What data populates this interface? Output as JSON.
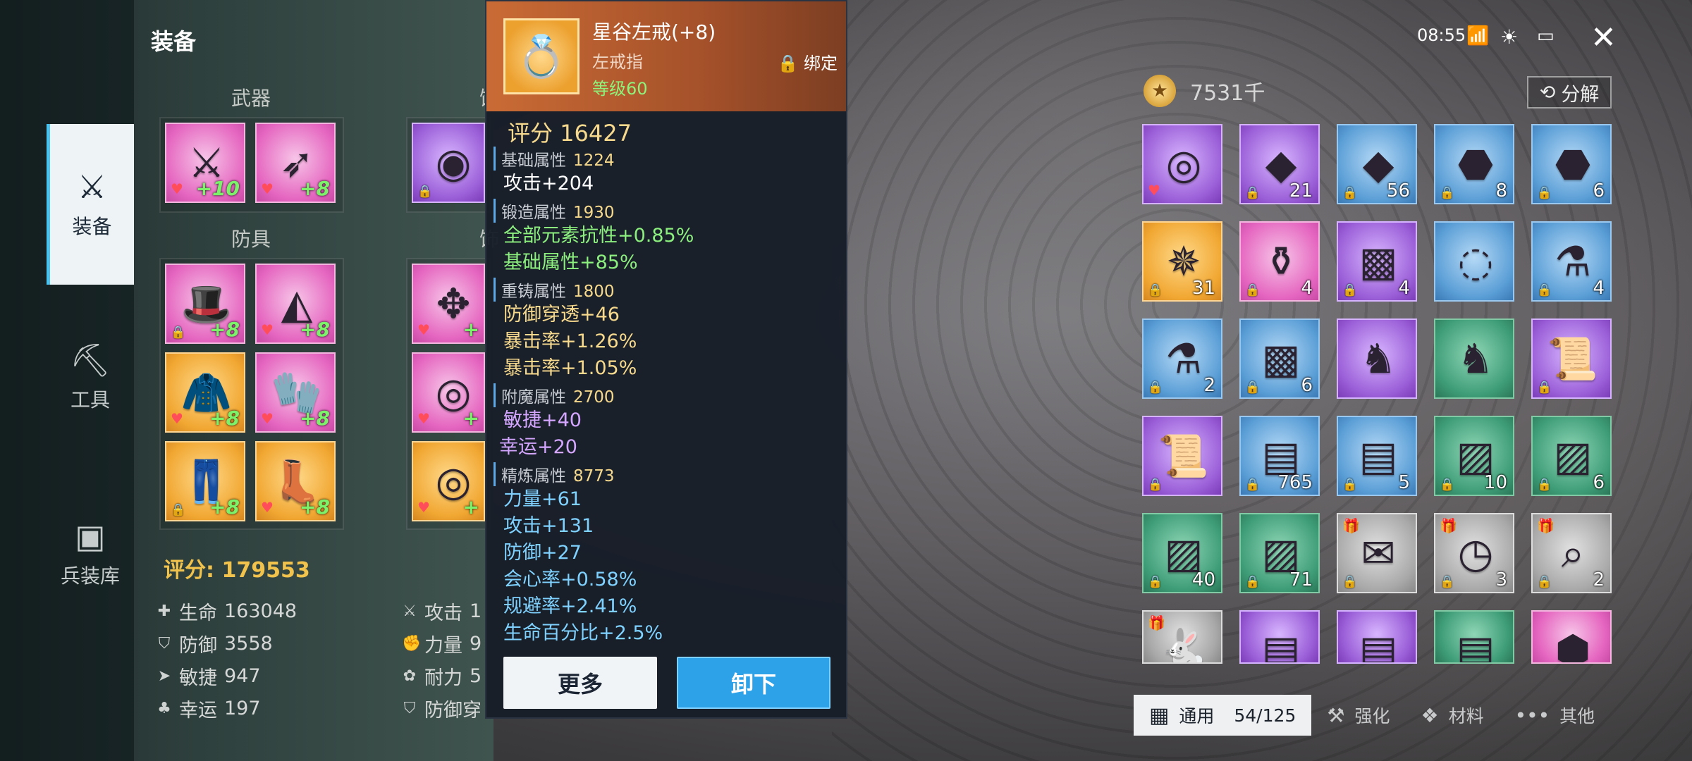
{
  "header": {
    "title": "装备",
    "time": "08:55"
  },
  "nav": [
    {
      "label": "装备",
      "icon": "sword-bag-icon",
      "active": true
    },
    {
      "label": "工具",
      "icon": "pickaxe-icon",
      "active": false
    },
    {
      "label": "兵装库",
      "icon": "chest-icon",
      "active": false
    }
  ],
  "equip": {
    "weapon_label": "武器",
    "armor_label": "防具",
    "weapons": [
      {
        "plus": "+10"
      },
      {
        "plus": "+8"
      }
    ],
    "armor": [
      {
        "plus": "+8"
      },
      {
        "plus": "+8"
      },
      {
        "plus": "+8"
      },
      {
        "plus": "+8"
      },
      {
        "plus": "+8"
      },
      {
        "plus": "+8"
      }
    ],
    "acc_label_a": "饰",
    "acc_label_b": "饰",
    "accessories": [
      {
        "plus": "+"
      },
      {
        "plus": "+"
      },
      {
        "plus": "+"
      }
    ],
    "score_label": "评分:",
    "score_value": "179553"
  },
  "stats": {
    "left": [
      {
        "icon": "heart-icon",
        "label": "生命",
        "value": "163048"
      },
      {
        "icon": "shield-icon",
        "label": "防御",
        "value": "3558"
      },
      {
        "icon": "agility-icon",
        "label": "敏捷",
        "value": "947"
      },
      {
        "icon": "clover-icon",
        "label": "幸运",
        "value": "197"
      }
    ],
    "right": [
      {
        "icon": "attack-icon",
        "label": "攻击",
        "value": "1"
      },
      {
        "icon": "strength-icon",
        "label": "力量",
        "value": "9"
      },
      {
        "icon": "paw-icon",
        "label": "耐力",
        "value": "5"
      },
      {
        "icon": "shield-pierce-icon",
        "label": "防御穿",
        "value": ""
      }
    ]
  },
  "tooltip": {
    "name": "星谷左戒(+8)",
    "type": "左戒指",
    "level": "等级60",
    "bind": "绑定",
    "score_text": "评分 16427",
    "sections": [
      {
        "title": "基础属性",
        "value": "1224",
        "lines": [
          {
            "text": "攻击+204",
            "color": "white"
          }
        ]
      },
      {
        "title": "锻造属性",
        "value": "1930",
        "lines": [
          {
            "text": "全部元素抗性+0.85%",
            "color": "green"
          },
          {
            "text": "基础属性+85%",
            "color": "green"
          }
        ]
      },
      {
        "title": "重铸属性",
        "value": "1800",
        "lines": [
          {
            "text": "防御穿透+46",
            "color": "yellow"
          },
          {
            "text": "暴击率+1.26%",
            "color": "yellow"
          },
          {
            "text": "暴击率+1.05%",
            "color": "yellow"
          }
        ]
      },
      {
        "title": "附魔属性",
        "value": "2700",
        "lines": [
          {
            "text": "敏捷+40",
            "color": "violet"
          },
          {
            "text": "幸运+20",
            "color": "violet"
          }
        ]
      },
      {
        "title": "精炼属性",
        "value": "8773",
        "lines": [
          {
            "text": "力量+61",
            "color": "cyan"
          },
          {
            "text": "攻击+131",
            "color": "cyan"
          },
          {
            "text": "防御+27",
            "color": "cyan"
          },
          {
            "text": "会心率+0.58%",
            "color": "cyan"
          },
          {
            "text": "规避率+2.41%",
            "color": "cyan"
          },
          {
            "text": "生命百分比+2.5%",
            "color": "cyan"
          }
        ]
      }
    ],
    "btn_more": "更多",
    "btn_unequip": "卸下"
  },
  "inventory": {
    "gold": "7531千",
    "decompose": "分解",
    "items": [
      {
        "icon": "ring-icon",
        "bg": "purple",
        "count": "",
        "heart": true,
        "lock": false,
        "gift": false
      },
      {
        "icon": "purple-crystal-icon",
        "bg": "purple",
        "count": "21",
        "heart": false,
        "lock": true,
        "gift": false
      },
      {
        "icon": "blue-crystal-icon",
        "bg": "blue",
        "count": "56",
        "heart": false,
        "lock": true,
        "gift": false
      },
      {
        "icon": "rune-stone-icon",
        "bg": "blue",
        "count": "8",
        "heart": false,
        "lock": true,
        "gift": false
      },
      {
        "icon": "rune-stone-icon",
        "bg": "blue",
        "count": "6",
        "heart": false,
        "lock": true,
        "gift": false
      },
      {
        "icon": "compass-icon",
        "bg": "gold",
        "count": "31",
        "heart": false,
        "lock": true,
        "gift": false
      },
      {
        "icon": "bottle-icon",
        "bg": "pink",
        "count": "4",
        "heart": false,
        "lock": true,
        "gift": false
      },
      {
        "icon": "cube-icon",
        "bg": "purple",
        "count": "4",
        "heart": false,
        "lock": true,
        "gift": false
      },
      {
        "icon": "powder-icon",
        "bg": "blue",
        "count": "",
        "heart": false,
        "lock": false,
        "gift": false
      },
      {
        "icon": "potion-icon",
        "bg": "blue",
        "count": "4",
        "heart": false,
        "lock": true,
        "gift": false
      },
      {
        "icon": "potion-icon",
        "bg": "blue",
        "count": "2",
        "heart": false,
        "lock": true,
        "gift": false
      },
      {
        "icon": "cube-icon",
        "bg": "blue",
        "count": "6",
        "heart": false,
        "lock": true,
        "gift": false
      },
      {
        "icon": "horse-icon",
        "bg": "purple",
        "count": "",
        "heart": false,
        "lock": false,
        "gift": false
      },
      {
        "icon": "horse-icon",
        "bg": "green",
        "count": "",
        "heart": false,
        "lock": false,
        "gift": false
      },
      {
        "icon": "scroll-icon",
        "bg": "purple",
        "count": "",
        "heart": false,
        "lock": true,
        "gift": false
      },
      {
        "icon": "scroll-icon",
        "bg": "purple",
        "count": "",
        "heart": false,
        "lock": true,
        "gift": false
      },
      {
        "icon": "case-icon",
        "bg": "blue",
        "count": "765",
        "heart": false,
        "lock": true,
        "gift": false
      },
      {
        "icon": "case-icon",
        "bg": "blue",
        "count": "5",
        "heart": false,
        "lock": true,
        "gift": false
      },
      {
        "icon": "pack-icon",
        "bg": "green",
        "count": "10",
        "heart": false,
        "lock": true,
        "gift": false
      },
      {
        "icon": "pack-icon",
        "bg": "green",
        "count": "6",
        "heart": false,
        "lock": true,
        "gift": false
      },
      {
        "icon": "pack-icon",
        "bg": "green",
        "count": "40",
        "heart": false,
        "lock": true,
        "gift": false
      },
      {
        "icon": "pack-icon",
        "bg": "green",
        "count": "71",
        "heart": false,
        "lock": true,
        "gift": false
      },
      {
        "icon": "stamp-icon",
        "bg": "grey",
        "count": "",
        "heart": false,
        "lock": true,
        "gift": true
      },
      {
        "icon": "watch-icon",
        "bg": "grey",
        "count": "3",
        "heart": false,
        "lock": true,
        "gift": true
      },
      {
        "icon": "telescope-icon",
        "bg": "grey",
        "count": "2",
        "heart": false,
        "lock": true,
        "gift": true
      },
      {
        "icon": "rabbit-icon",
        "bg": "grey",
        "count": "",
        "heart": false,
        "lock": false,
        "gift": true
      },
      {
        "icon": "case-icon",
        "bg": "purple",
        "count": "",
        "heart": false,
        "lock": false,
        "gift": false
      },
      {
        "icon": "case-icon",
        "bg": "purple",
        "count": "",
        "heart": false,
        "lock": false,
        "gift": false
      },
      {
        "icon": "case-icon",
        "bg": "green",
        "count": "",
        "heart": false,
        "lock": false,
        "gift": false
      },
      {
        "icon": "gem-icon",
        "bg": "pink",
        "count": "",
        "heart": false,
        "lock": false,
        "gift": false
      }
    ]
  },
  "tabs": [
    {
      "label": "通用",
      "icon": "grid-icon",
      "active": true,
      "capacity": "54/125"
    },
    {
      "label": "强化",
      "icon": "anvil-icon",
      "active": false,
      "capacity": ""
    },
    {
      "label": "材料",
      "icon": "material-icon",
      "active": false,
      "capacity": ""
    },
    {
      "label": "其他",
      "icon": "dots-icon",
      "active": false,
      "capacity": ""
    }
  ],
  "colors": {
    "accent": "#2ea2e8",
    "score": "#f2c34c",
    "plus": "#7cf26b",
    "tooltip_header": "#c96b35"
  }
}
